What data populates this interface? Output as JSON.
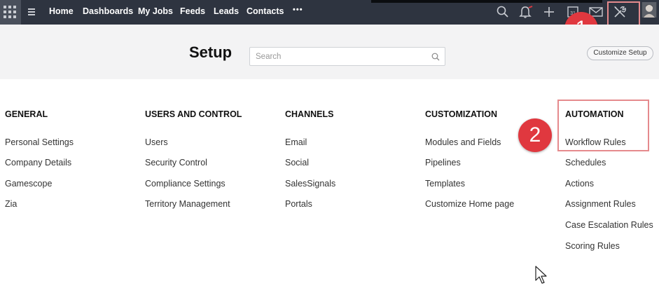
{
  "nav": {
    "items": [
      "Home",
      "Dashboards",
      "My Jobs",
      "Feeds",
      "Leads",
      "Contacts"
    ],
    "more": "•••",
    "calendar_day": "31"
  },
  "header": {
    "title": "Setup",
    "search_placeholder": "Search",
    "customize_label": "Customize Setup"
  },
  "columns": [
    {
      "title": "GENERAL",
      "links": [
        "Personal Settings",
        "Company Details",
        "Gamescope",
        "Zia"
      ]
    },
    {
      "title": "USERS AND CONTROL",
      "links": [
        "Users",
        "Security Control",
        "Compliance Settings",
        "Territory Management"
      ]
    },
    {
      "title": "CHANNELS",
      "links": [
        "Email",
        "Social",
        "SalesSignals",
        "Portals"
      ]
    },
    {
      "title": "CUSTOMIZATION",
      "links": [
        "Modules and Fields",
        "Pipelines",
        "Templates",
        "Customize Home page"
      ]
    },
    {
      "title": "AUTOMATION",
      "links": [
        "Workflow Rules",
        "Schedules",
        "Actions",
        "Assignment Rules",
        "Case Escalation Rules",
        "Scoring Rules"
      ]
    }
  ],
  "annotations": {
    "badge1": "1",
    "badge2": "2"
  },
  "colors": {
    "topbar": "#2e3440",
    "annotation": "#e0383f",
    "highlight": "#e58a8d"
  }
}
